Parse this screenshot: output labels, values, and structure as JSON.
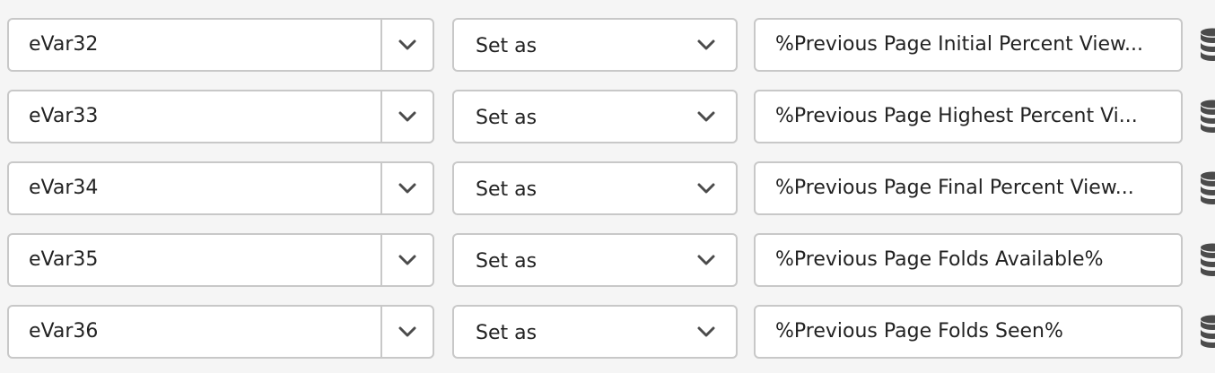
{
  "rows": [
    {
      "variable": "eVar32",
      "operator": "Set as",
      "value": "%Previous Page Initial Percent View..."
    },
    {
      "variable": "eVar33",
      "operator": "Set as",
      "value": "%Previous Page Highest Percent Vi..."
    },
    {
      "variable": "eVar34",
      "operator": "Set as",
      "value": "%Previous Page Final Percent View..."
    },
    {
      "variable": "eVar35",
      "operator": "Set as",
      "value": "%Previous Page Folds Available%"
    },
    {
      "variable": "eVar36",
      "operator": "Set as",
      "value": "%Previous Page Folds Seen%"
    }
  ],
  "icons": {
    "dropdown": "chevron-down-icon",
    "data_element": "database-icon"
  },
  "colors": {
    "background": "#f5f5f5",
    "field_border": "#c8c8c8",
    "text": "#222222",
    "icon": "#4b4b4b"
  }
}
